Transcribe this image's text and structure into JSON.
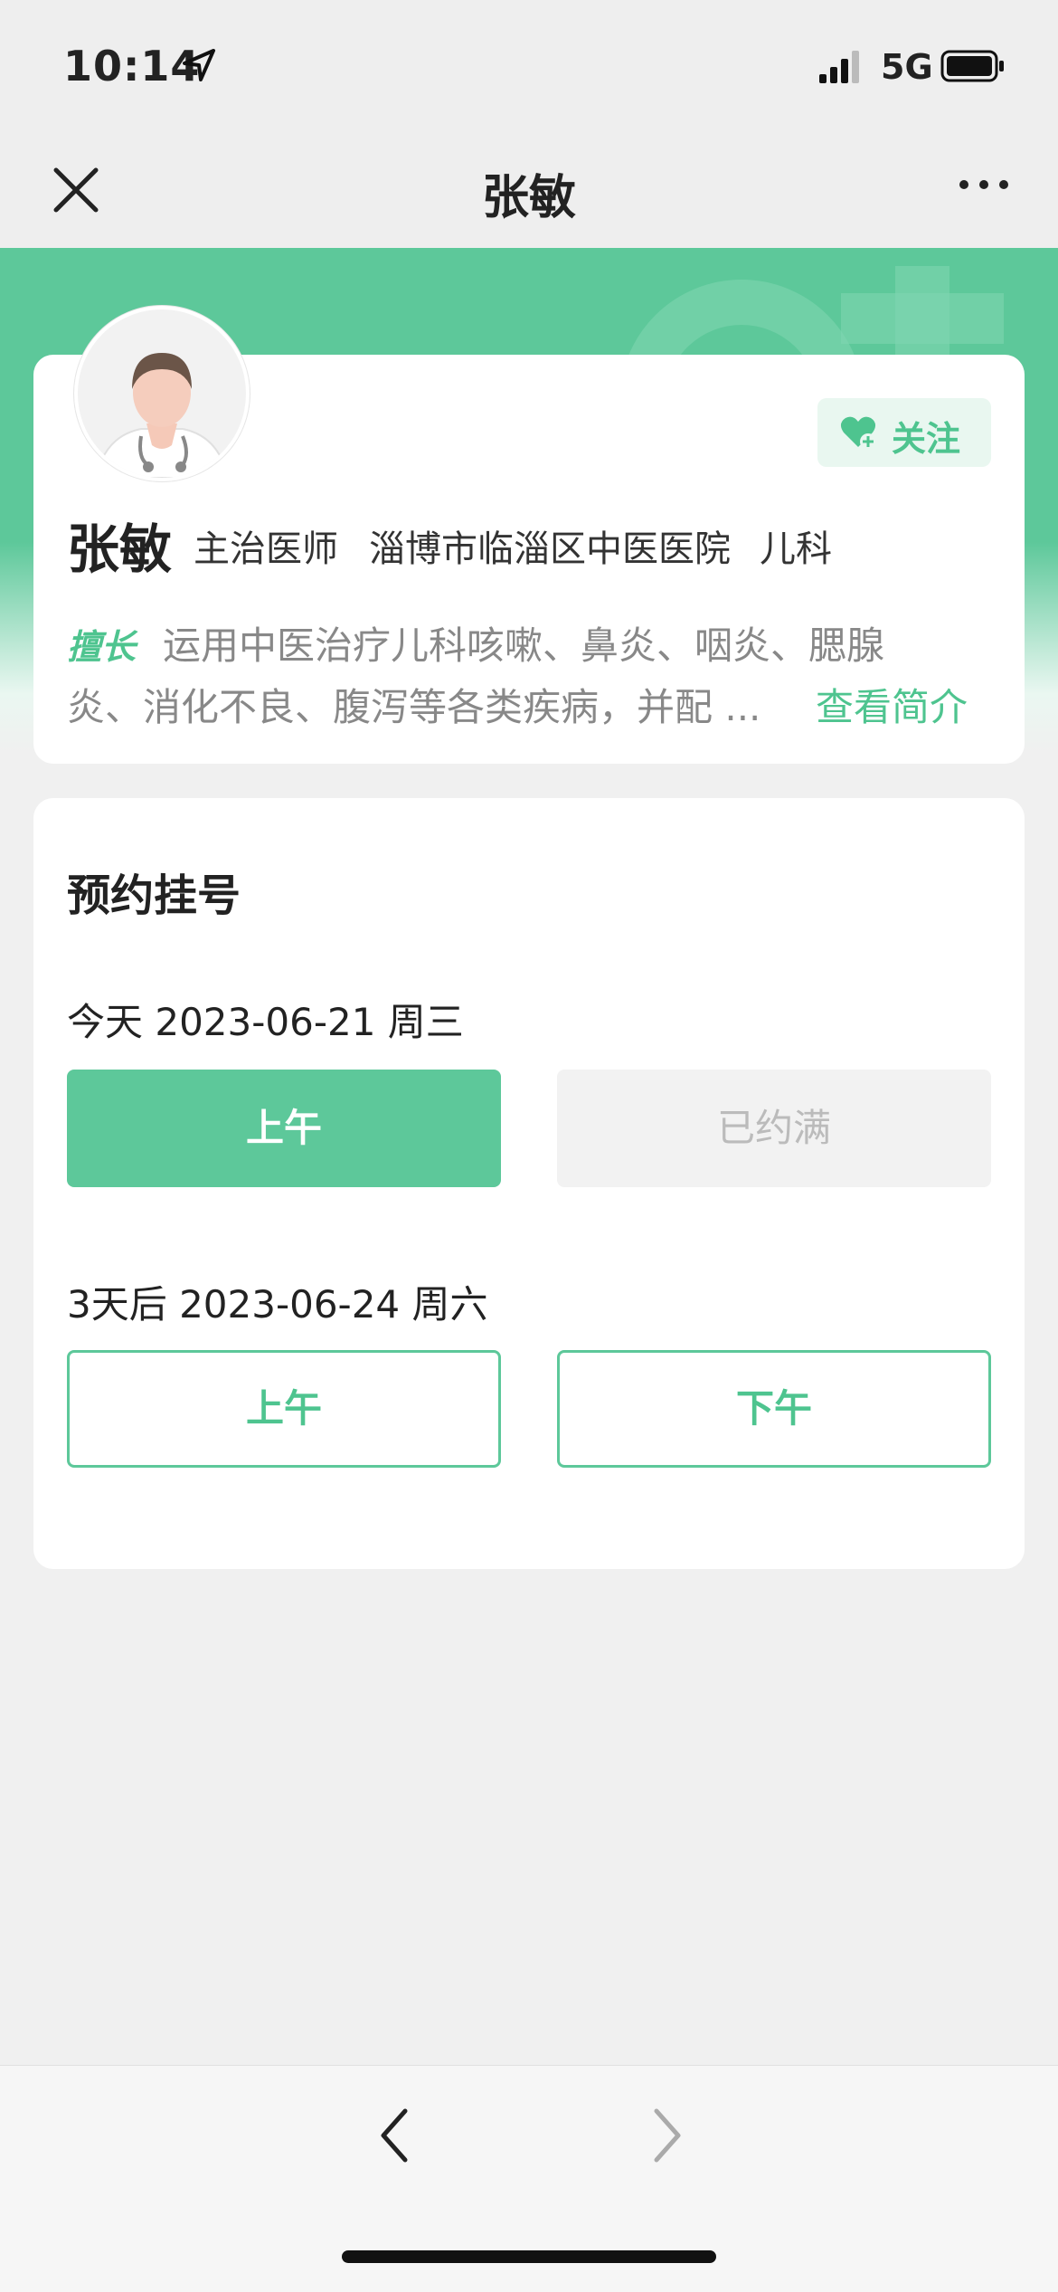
{
  "status": {
    "time": "10:14",
    "network": "5G"
  },
  "nav": {
    "title": "张敏"
  },
  "doctor": {
    "name": "张敏",
    "title": "主治医师",
    "hospital": "淄博市临淄区中医医院",
    "department": "儿科",
    "follow_label": "关注",
    "expertise_tag": "擅长",
    "expertise_line1": "运用中医治疗儿科咳嗽、鼻炎、咽炎、腮腺",
    "expertise_line2": "炎、消化不良、腹泻等各类疾病，并配 ...",
    "intro_link": "查看简介"
  },
  "booking": {
    "title": "预约挂号",
    "days": [
      {
        "label": "今天   2023-06-21 周三",
        "slots": [
          {
            "label": "上午",
            "state": "available"
          },
          {
            "label": "已约满",
            "state": "full"
          }
        ]
      },
      {
        "label": "3天后   2023-06-24 周六",
        "slots": [
          {
            "label": "上午",
            "state": "available"
          },
          {
            "label": "下午",
            "state": "available"
          }
        ]
      }
    ]
  },
  "colors": {
    "accent": "#5dc89a",
    "accent_text": "#4ec48f",
    "background": "#f0f0f0"
  },
  "icons": [
    "location-arrow-icon",
    "signal-icon",
    "battery-icon",
    "close-icon",
    "more-icon",
    "heart-plus-icon",
    "back-arrow-icon",
    "forward-arrow-icon"
  ]
}
